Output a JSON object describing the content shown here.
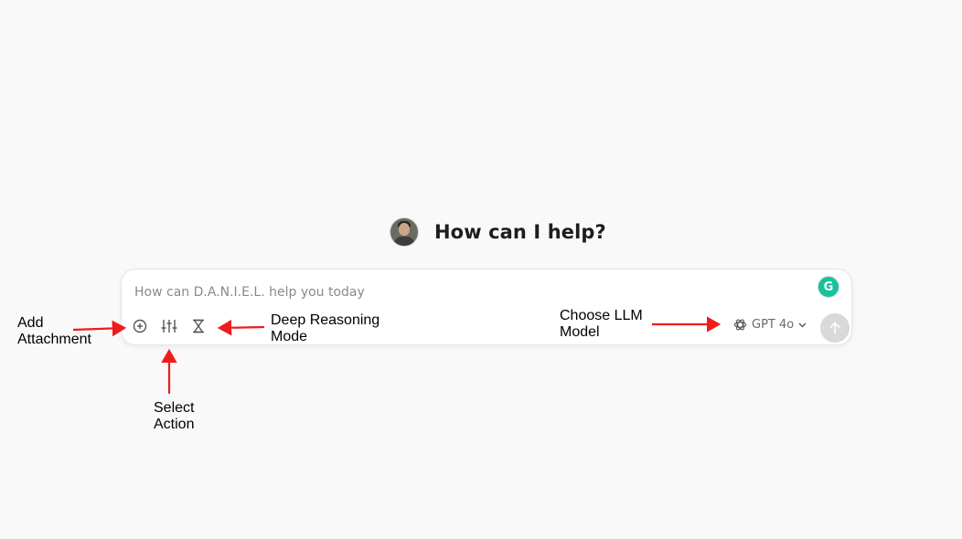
{
  "header": {
    "title": "How can I help?"
  },
  "composer": {
    "placeholder": "How can D.A.N.I.E.L. help you today",
    "grammarly_letter": "G",
    "tools": [
      {
        "icon": "add-circle-icon"
      },
      {
        "icon": "sliders-icon"
      },
      {
        "icon": "hourglass-icon"
      }
    ],
    "model": {
      "icon": "openai-logo-icon",
      "label": "GPT 4o"
    },
    "send_icon": "arrow-up-icon"
  },
  "annotations": {
    "add_attachment": [
      "Add",
      "Attachment"
    ],
    "select_action": [
      "Select",
      "Action"
    ],
    "deep_reasoning": [
      "Deep Reasoning",
      "Mode"
    ],
    "choose_model": [
      "Choose LLM",
      "Model"
    ],
    "arrow_color": "#ee1c1c"
  }
}
